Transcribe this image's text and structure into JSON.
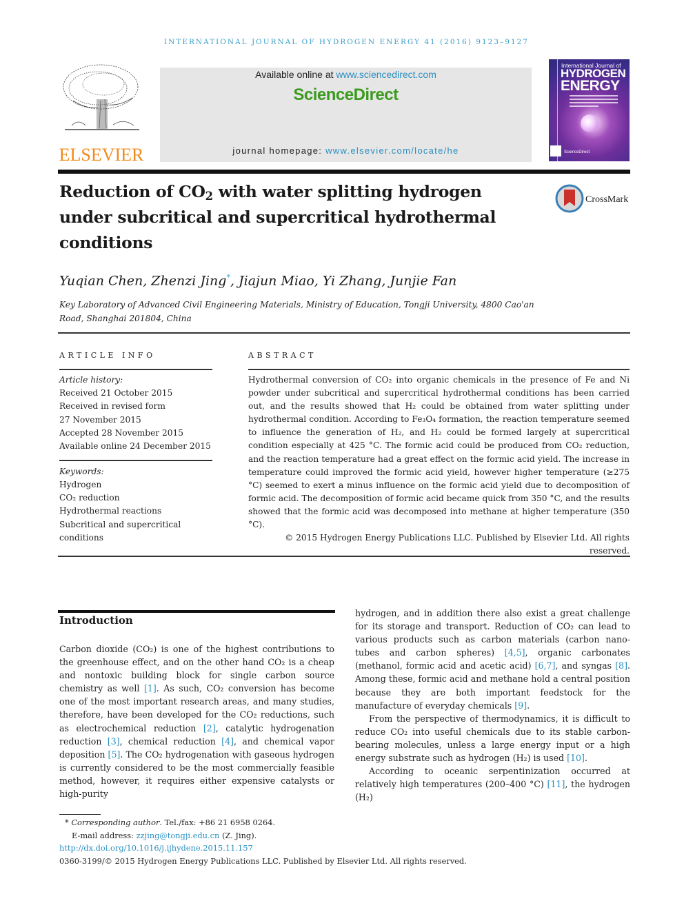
{
  "header": {
    "running_head": "INTERNATIONAL JOURNAL OF HYDROGEN ENERGY 41 (2016) 9123–9127",
    "publisher_logo_text": "ELSEVIER",
    "available_online_prefix": "Available online at ",
    "available_online_link": "www.sciencedirect.com",
    "platform_name": "ScienceDirect",
    "homepage_prefix": "journal homepage: ",
    "homepage_link": "www.elsevier.com/locate/he",
    "cover": {
      "line1": "International Journal of",
      "line2": "HYDROGEN",
      "line3": "ENERGY",
      "footer": "ScienceDirect"
    }
  },
  "article": {
    "title_part1": "Reduction of CO",
    "title_sub": "2",
    "title_part2": " with water splitting hydrogen under subcritical and supercritical hydrothermal conditions",
    "crossmark_label": "CrossMark",
    "authors_before": "Yuqian Chen, Zhenzi Jing",
    "corresponding_marker": "*",
    "authors_after": ", Jiajun Miao, Yi Zhang, Junjie Fan",
    "affiliation": "Key Laboratory of Advanced Civil Engineering Materials, Ministry of Education, Tongji University, 4800 Cao'an Road, Shanghai 201804, China"
  },
  "article_info": {
    "heading": "ARTICLE INFO",
    "history_label": "Article history:",
    "history": [
      "Received 21 October 2015",
      "Received in revised form",
      "27 November 2015",
      "Accepted 28 November 2015",
      "Available online 24 December 2015"
    ],
    "keywords_label": "Keywords:",
    "keywords": [
      "Hydrogen",
      "CO₂ reduction",
      "Hydrothermal reactions",
      "Subcritical and supercritical conditions"
    ]
  },
  "abstract": {
    "heading": "ABSTRACT",
    "text": "Hydrothermal conversion of CO₂ into organic chemicals in the presence of Fe and Ni powder under subcritical and supercritical hydrothermal conditions has been carried out, and the results showed that H₂ could be obtained from water splitting under hydrothermal condition. According to Fe₃O₄ formation, the reaction temperature seemed to influence the generation of H₂, and H₂ could be formed largely at supercritical condition especially at 425 °C. The formic acid could be produced from CO₂ reduction, and the reaction temperature had a great effect on the formic acid yield. The increase in temperature could improved the formic acid yield, however higher temperature (≥275 °C) seemed to exert a minus influence on the formic acid yield due to decomposition of formic acid. The decomposition of formic acid became quick from 350 °C, and the results showed that the formic acid was decomposed into methane at higher temperature (350 °C).",
    "copyright": "© 2015 Hydrogen Energy Publications LLC. Published by Elsevier Ltd. All rights reserved."
  },
  "introduction": {
    "heading": "Introduction",
    "left_col": [
      {
        "t": "Carbon dioxide (CO₂) is one of the highest contributions to the greenhouse effect, and on the other hand CO₂ is a cheap and nontoxic building block for single carbon source chemistry as well "
      },
      {
        "r": "[1]"
      },
      {
        "t": ". As such, CO₂ conversion has become one of the most important research areas, and many studies, therefore, have been developed for the CO₂ reductions, such as electrochemical reduction "
      },
      {
        "r": "[2]"
      },
      {
        "t": ", catalytic hydrogenation reduction "
      },
      {
        "r": "[3]"
      },
      {
        "t": ", chemical reduction "
      },
      {
        "r": "[4]"
      },
      {
        "t": ", and chemical vapor deposition "
      },
      {
        "r": "[5]"
      },
      {
        "t": ". The CO₂ hydrogenation with gaseous hydrogen is currently considered to be the most commercially feasible method, however, it requires either expensive catalysts or high-purity"
      }
    ],
    "right_p1": [
      {
        "t": "hydrogen, and in addition there also exist a great challenge for its storage and transport. Reduction of CO₂ can lead to various products such as carbon materials (carbon nano-tubes and carbon spheres) "
      },
      {
        "r": "[4,5]"
      },
      {
        "t": ", organic carbonates (methanol, formic acid and acetic acid) "
      },
      {
        "r": "[6,7]"
      },
      {
        "t": ", and syngas "
      },
      {
        "r": "[8]"
      },
      {
        "t": ". Among these, formic acid and methane hold a central position because they are both important feedstock for the manufacture of everyday chemicals "
      },
      {
        "r": "[9]"
      },
      {
        "t": "."
      }
    ],
    "right_p2": [
      {
        "t": "From the perspective of thermodynamics, it is difficult to reduce CO₂ into useful chemicals due to its stable carbon-bearing molecules, unless a large energy input or a high energy substrate such as hydrogen (H₂) is used "
      },
      {
        "r": "[10]"
      },
      {
        "t": "."
      }
    ],
    "right_p3": [
      {
        "t": "According to oceanic serpentinization occurred at relatively high temperatures (200–400 °C) "
      },
      {
        "r": "[11]"
      },
      {
        "t": ", the hydrogen (H₂)"
      }
    ]
  },
  "footnotes": {
    "marker": "*",
    "corresponding_label": "Corresponding author",
    "tel": ". Tel./fax: +86 21 6958 0264.",
    "email_label": "E-mail address: ",
    "email": "zzjing@tongji.edu.cn",
    "email_suffix": " (Z. Jing).",
    "doi": "http://dx.doi.org/10.1016/j.ijhydene.2015.11.157",
    "issn_line": "0360-3199/© 2015 Hydrogen Energy Publications LLC. Published by Elsevier Ltd. All rights reserved."
  }
}
